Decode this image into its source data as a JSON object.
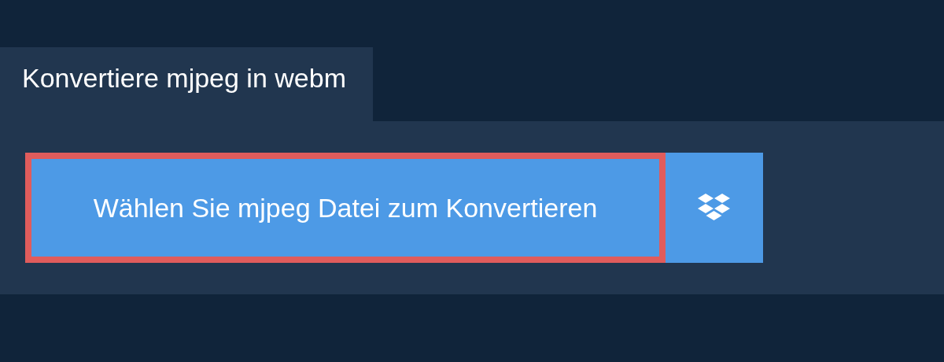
{
  "tab": {
    "label": "Konvertiere mjpeg in webm"
  },
  "choose_button": {
    "label": "Wählen Sie mjpeg Datei zum Konvertieren",
    "focused": true
  }
}
